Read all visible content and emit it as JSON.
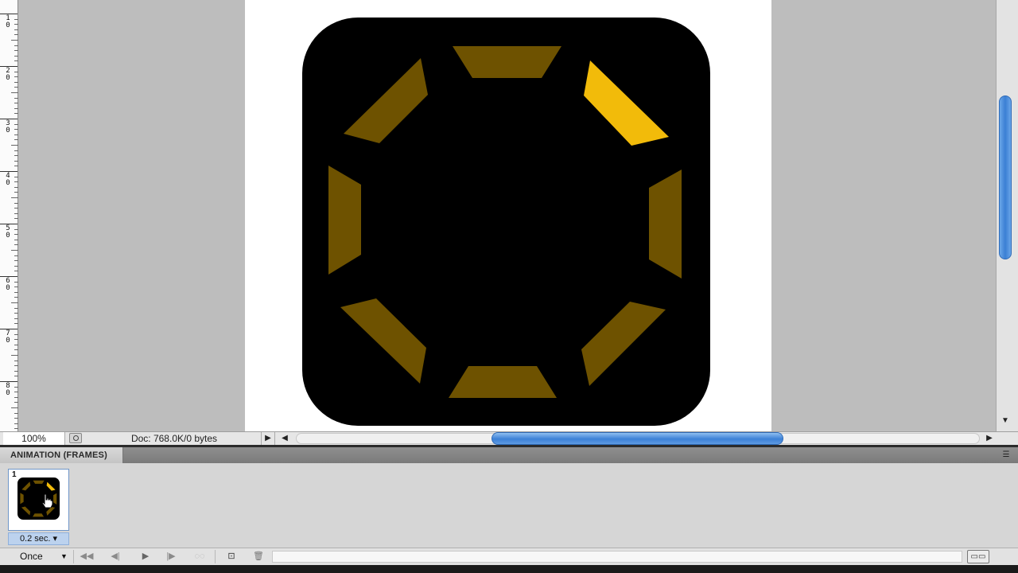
{
  "ruler": {
    "labels": [
      "1\n0",
      "2\n0",
      "3\n0",
      "4\n0",
      "5\n0",
      "6\n0",
      "7\n0",
      "8\n0"
    ]
  },
  "artwork": {
    "colors": {
      "background": "#000000",
      "segment_dim": "#6e5200",
      "segment_active": "#f2bb0a"
    },
    "segments": 8,
    "active_segment": "top-right"
  },
  "status_bar": {
    "zoom": "100%",
    "doc_info": "Doc: 768.0K/0 bytes",
    "menu_arrow": "▶",
    "scroll_left": "◀",
    "scroll_right": "▶"
  },
  "scrollbars": {
    "vertical_down": "▼",
    "accent": "#3b7fd4"
  },
  "panel": {
    "title": "ANIMATION (FRAMES)",
    "menu_icon": "☰",
    "frame": {
      "number": "1",
      "delay": "0.2 sec."
    },
    "delay_arrow": "▾"
  },
  "controls": {
    "loop": "Once",
    "loop_arrow": "▼",
    "first_frame": "◀◀",
    "prev_frame": "◀|",
    "play": "▶",
    "next_frame": "|▶",
    "tween": "◌◌",
    "duplicate": "⊡",
    "delete": "🗑"
  }
}
